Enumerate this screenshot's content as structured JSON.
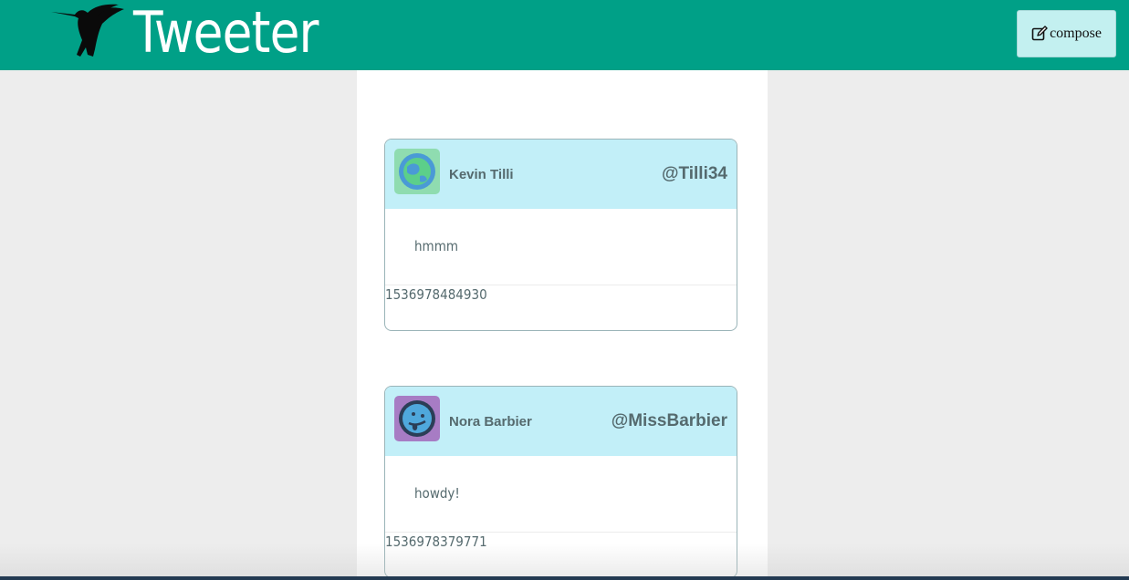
{
  "header": {
    "brand": "Tweeter",
    "logo_icon": "hummingbird-icon",
    "compose_label": "compose",
    "compose_icon": "edit-icon",
    "color": "#00a087"
  },
  "tweets": [
    {
      "name": "Kevin Tilli",
      "handle": "@Tilli34",
      "content": "hmmm",
      "timestamp": "1536978484930",
      "avatar_icon": "globe-face-icon"
    },
    {
      "name": "Nora Barbier",
      "handle": "@MissBarbier",
      "content": "howdy!",
      "timestamp": "1536978379771",
      "avatar_icon": "tongue-face-icon"
    }
  ]
}
